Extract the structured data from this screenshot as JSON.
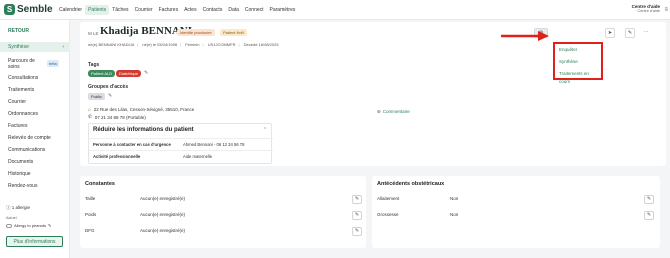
{
  "app": {
    "logo_letter": "S",
    "logo_text": "Semble"
  },
  "nav": {
    "items": [
      "Calendrier",
      "Patients",
      "Tâches",
      "Courrier",
      "Factures",
      "Actes",
      "Contacts",
      "Data",
      "Connect",
      "Paramètres"
    ],
    "active": "Patients"
  },
  "centre": {
    "name": "Centre d'aide",
    "sub": "Centre d'aide"
  },
  "sidebar": {
    "back": "RETOUR",
    "items": [
      "Synthèse",
      "Parcours de soins",
      "Consultations",
      "Traitements",
      "Courrier",
      "Ordonnances",
      "Factures",
      "Relevés de compte",
      "Communications",
      "Documents",
      "Historique",
      "Rendez-vous"
    ],
    "beta": "bêta",
    "allergy_count": "1 allergie",
    "actuel": "Actuel",
    "allergy": "Allergy to peanuts",
    "more_info": "Plus d'informations"
  },
  "patient": {
    "salutation": "M LE",
    "name": "Khadija BENNANI",
    "badge_identity": "Identité provisoire",
    "badge_fictif": "Patient fictif",
    "meta": [
      "né(e) BENNANI KHADIJA",
      "né(e) le 03/04/1998",
      "Féminin",
      "US1JCOMMFR",
      "Décédé 16/08/2025"
    ]
  },
  "actions": {
    "gear": "⚙",
    "send": "➤",
    "edit": "✎",
    "more": "⋯"
  },
  "dropdown": [
    "Enquêter",
    "Synthèse",
    "Traitements en cours"
  ],
  "tags": {
    "title": "Tags",
    "items": [
      "Patient ALD",
      "Diabétique"
    ]
  },
  "groups": {
    "title": "Groupes d'accès",
    "items": [
      "Public"
    ]
  },
  "contact": {
    "address": "22 Rue des Lilas, Cesson-Sévigné, 35510, France",
    "phone": "07 21 34 89 78 (Portable)",
    "comment": "Commentaire"
  },
  "reduce": {
    "title": "Réduire les informations du patient",
    "rows": [
      {
        "k": "Personne à contacter en cas d'urgence",
        "v": "Ahmed Bennani - 06 12 34 56 78"
      },
      {
        "k": "Activité professionnelle",
        "v": "Aide maternelle"
      }
    ]
  },
  "constantes": {
    "title": "Constantes",
    "rows": [
      {
        "k": "Taille",
        "v": "Aucun(e) enregistré(e)"
      },
      {
        "k": "Poids",
        "v": "Aucun(e) enregistré(e)"
      },
      {
        "k": "DFG",
        "v": "Aucun(e) enregistré(e)"
      }
    ]
  },
  "obstetric": {
    "title": "Antécédents obstétricaux",
    "rows": [
      {
        "k": "Allaitement",
        "v": "Non"
      },
      {
        "k": "Grossesse",
        "v": "Non"
      }
    ]
  },
  "colors": {
    "brand": "#2e7d5b",
    "highlight": "#e0201a"
  }
}
